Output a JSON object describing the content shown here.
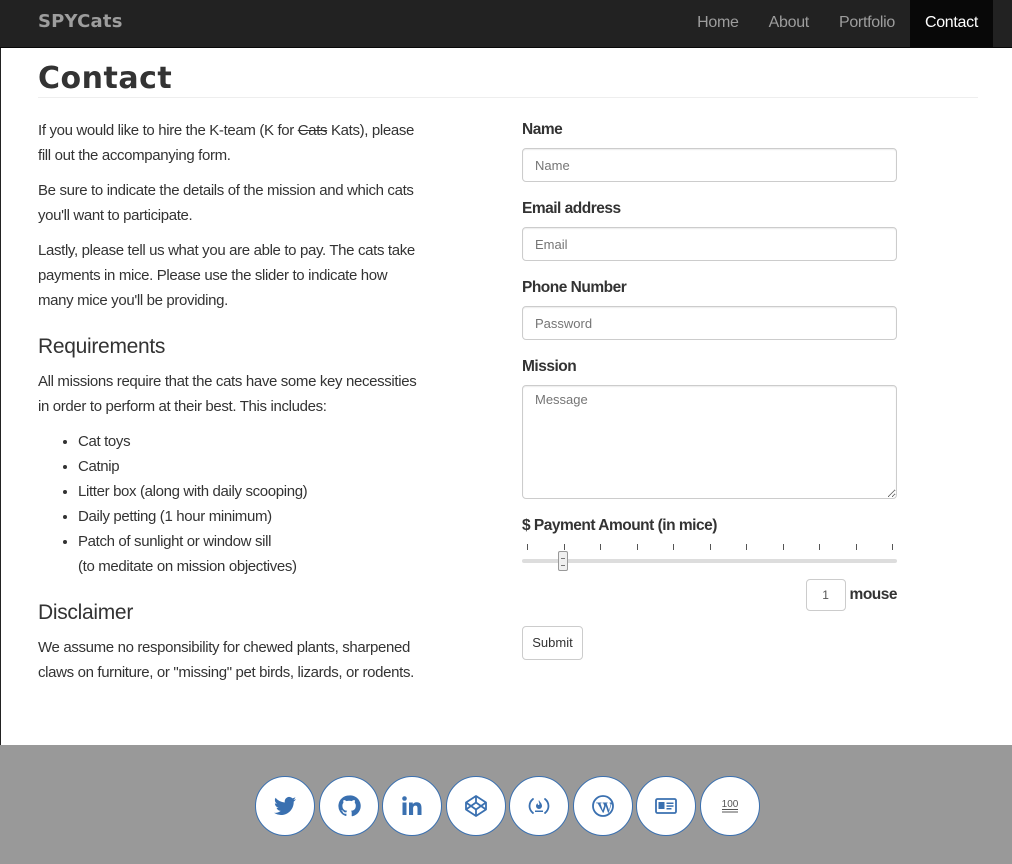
{
  "navbar": {
    "brand": "SPYCats",
    "items": [
      {
        "label": "Home",
        "active": false
      },
      {
        "label": "About",
        "active": false
      },
      {
        "label": "Portfolio",
        "active": false
      },
      {
        "label": "Contact",
        "active": true
      }
    ]
  },
  "page": {
    "title": "Contact"
  },
  "left": {
    "p1_a": "If you would like to hire the K-team (K for ",
    "p1_strike": "Cats",
    "p1_b": " Kats), please fill out the accompanying form.",
    "p2": "Be sure to indicate the details of the mission and which cats you'll want to participate.",
    "p3": "Lastly, please tell us what you are able to pay. The cats take payments in mice. Please use the slider to indicate how many mice you'll be providing.",
    "requirements_heading": "Requirements",
    "requirements_intro": "All missions require that the cats have some key necessities in order to perform at their best. This includes:",
    "requirements": [
      "Cat toys",
      "Catnip",
      "Litter box (along with daily scooping)",
      "Daily petting (1 hour minimum)",
      "Patch of sunlight or window sill",
      "(to meditate on mission objectives)"
    ],
    "disclaimer_heading": "Disclaimer",
    "disclaimer": "We assume no responsibility for chewed plants, sharpened claws on furniture, or \"missing\" pet birds, lizards, or rodents."
  },
  "form": {
    "name_label": "Name",
    "name_placeholder": "Name",
    "email_label": "Email address",
    "email_placeholder": "Email",
    "phone_label": "Phone Number",
    "phone_placeholder": "Password",
    "mission_label": "Mission",
    "mission_placeholder": "Message",
    "payment_label": "$ Payment Amount (in mice)",
    "payment_value": 1,
    "payment_unit": "mouse",
    "slider_level": 0.11,
    "submit_label": "Submit"
  },
  "footer": {
    "social": [
      {
        "icon": "twitter-icon",
        "text": ""
      },
      {
        "icon": "github-icon",
        "text": ""
      },
      {
        "icon": "linkedin-icon",
        "text": ""
      },
      {
        "icon": "codepen-icon",
        "text": ""
      },
      {
        "icon": "freecodecamp-icon",
        "text": ""
      },
      {
        "icon": "wordpress-icon",
        "text": ""
      },
      {
        "icon": "contact-card-icon",
        "text": ""
      },
      {
        "icon": "100-icon",
        "text": "100"
      }
    ],
    "accent_color": "#3a70b0"
  }
}
